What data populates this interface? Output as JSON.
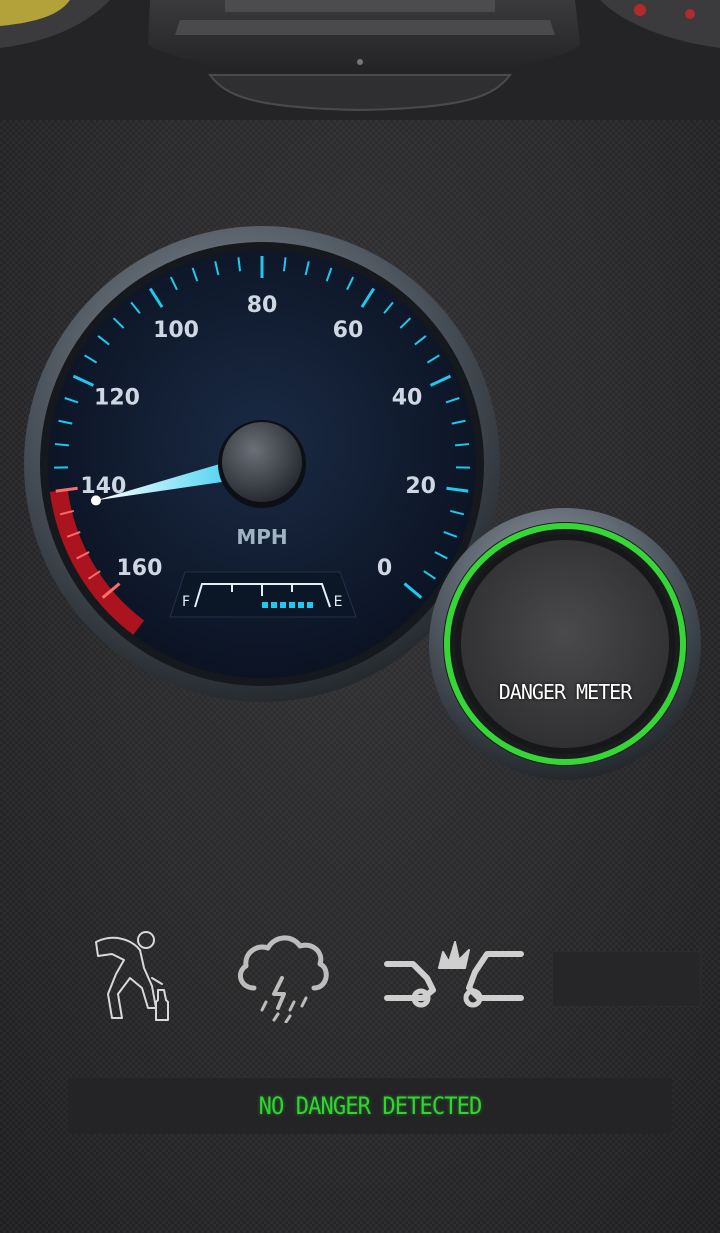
{
  "speedometer": {
    "unit": "MPH",
    "ticks": [
      "0",
      "20",
      "40",
      "60",
      "80",
      "100",
      "120",
      "140",
      "160"
    ],
    "fuel_full_label": "F",
    "fuel_empty_label": "E",
    "needle_value_mph": 143,
    "accent_color": "#1ec8ee",
    "redline_color": "#e0141c"
  },
  "danger_meter": {
    "label": "DANGER METER",
    "ring_color": "#35d635"
  },
  "danger_icons": [
    {
      "icon": "drunk-person-icon"
    },
    {
      "icon": "thunderstorm-icon"
    },
    {
      "icon": "car-crash-icon"
    },
    {
      "icon": "empty-slot"
    }
  ],
  "status": {
    "text": "NO DANGER DETECTED",
    "color": "#2ed62e"
  }
}
